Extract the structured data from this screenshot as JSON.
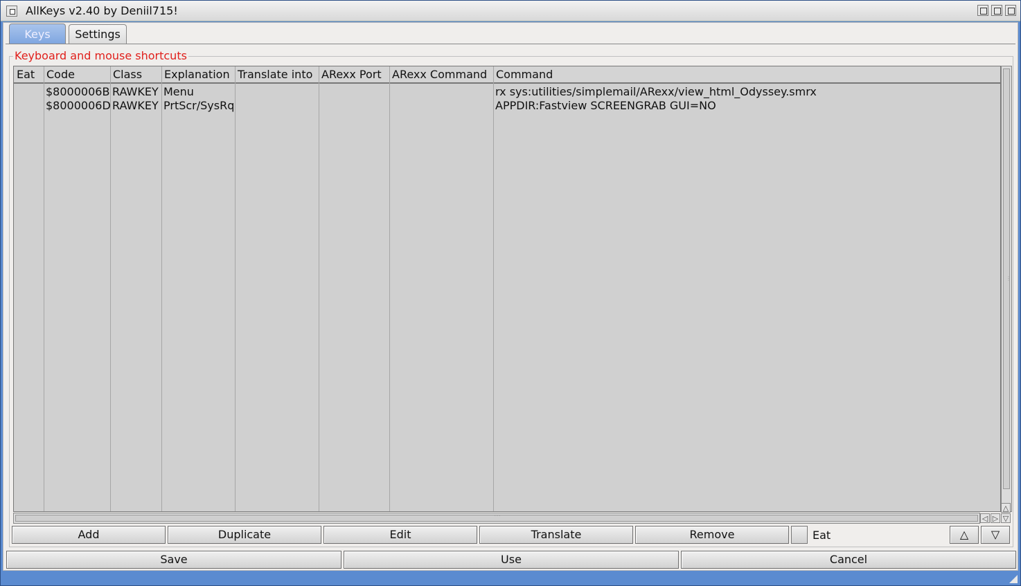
{
  "window": {
    "title": "AllKeys v2.40 by Deniil715!"
  },
  "tabs": [
    {
      "label": "Keys",
      "active": true
    },
    {
      "label": "Settings",
      "active": false
    }
  ],
  "group_title": "Keyboard and mouse shortcuts",
  "table": {
    "columns": [
      "Eat",
      "Code",
      "Class",
      "Explanation",
      "Translate into",
      "ARexx Port",
      "ARexx Command",
      "Command"
    ],
    "rows": [
      {
        "eat": "",
        "code": "$8000006B",
        "class": "RAWKEY",
        "explanation": "Menu",
        "translate": "",
        "arexx_port": "",
        "arexx_command": "",
        "command": "rx sys:utilities/simplemail/ARexx/view_html_Odyssey.smrx"
      },
      {
        "eat": "",
        "code": "$8000006D",
        "class": "RAWKEY",
        "explanation": "PrtScr/SysRq",
        "translate": "",
        "arexx_port": "",
        "arexx_command": "",
        "command": "APPDIR:Fastview SCREENGRAB GUI=NO"
      }
    ]
  },
  "actions": {
    "add": "Add",
    "duplicate": "Duplicate",
    "edit": "Edit",
    "translate": "Translate",
    "remove": "Remove",
    "eat_label": "Eat",
    "eat_checked": false,
    "move_up": "△",
    "move_down": "▽"
  },
  "footer": {
    "save": "Save",
    "use": "Use",
    "cancel": "Cancel"
  },
  "colors": {
    "accent": "#5b8bd0",
    "group_title": "#e0201c",
    "list_bg": "#d0d0d0"
  }
}
